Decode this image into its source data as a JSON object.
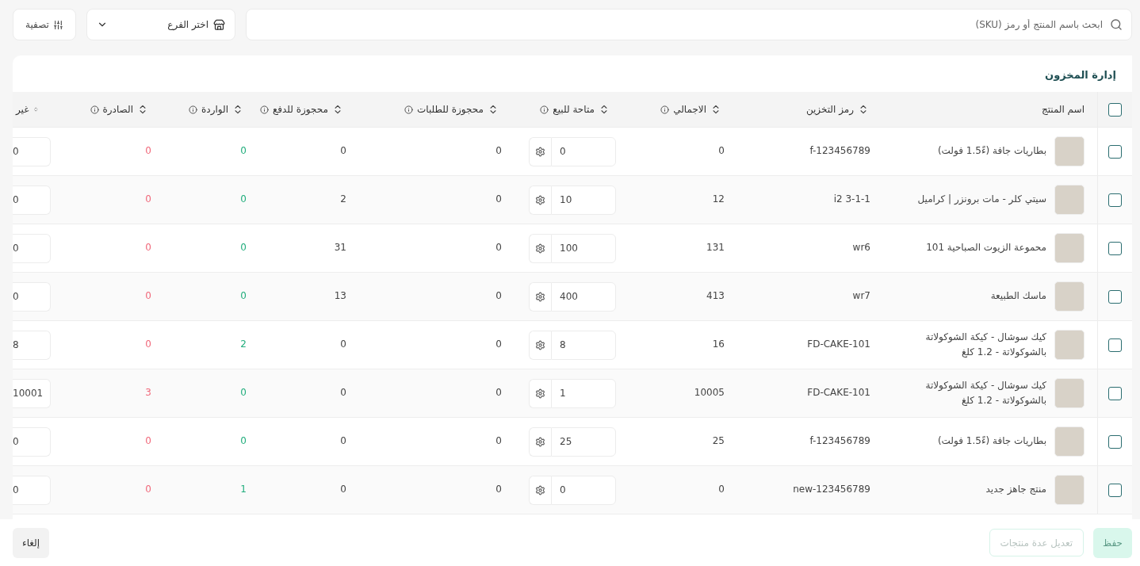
{
  "toolbar": {
    "search": {
      "placeholder": "ابحث باسم المنتج أو رمز (SKU)"
    },
    "branch_select": {
      "placeholder": "اختر الفرع"
    },
    "filter_button": {
      "label": "تصفية"
    }
  },
  "panel": {
    "title": "إدارة المخزون"
  },
  "table": {
    "select_all": {
      "checked": false
    },
    "columns": [
      {
        "label": "اسم المنتج",
        "sortable": false,
        "info": false
      },
      {
        "label": "رمز التخزين",
        "sortable": true,
        "info": false
      },
      {
        "label": "الاجمالي",
        "sortable": true,
        "info": true
      },
      {
        "label": "متاحة للبيع",
        "sortable": true,
        "info": true
      },
      {
        "label": "محجوزة للطلبات",
        "sortable": true,
        "info": true
      },
      {
        "label": "محجوزة للدفع",
        "sortable": true,
        "info": true
      },
      {
        "label": "الواردة",
        "sortable": true,
        "info": true
      },
      {
        "label": "الصادرة",
        "sortable": true,
        "info": true
      },
      {
        "label": "غير",
        "sortable": true,
        "info": false
      }
    ],
    "rows": [
      {
        "checked": false,
        "name": "بطاريات جافة (ءً1.5 فولت)",
        "sku": "f-123456789",
        "total": "0",
        "available": "0",
        "reserved_orders": "0",
        "reserved_payment": "0",
        "incoming": "0",
        "outgoing": "0",
        "column_9": "0"
      },
      {
        "checked": false,
        "name": "سيتي كلر - مات برونزر | كراميل",
        "sku": "i2 3-1-1",
        "total": "12",
        "available": "10",
        "reserved_orders": "0",
        "reserved_payment": "2",
        "incoming": "0",
        "outgoing": "0",
        "column_9": "0"
      },
      {
        "checked": false,
        "name": "محموعة الزيوت الصباحية 101",
        "sku": "wr6",
        "total": "131",
        "available": "100",
        "reserved_orders": "0",
        "reserved_payment": "31",
        "incoming": "0",
        "outgoing": "0",
        "column_9": "0"
      },
      {
        "checked": false,
        "name": "ماسك الطبيعة",
        "sku": "wr7",
        "total": "413",
        "available": "400",
        "reserved_orders": "0",
        "reserved_payment": "13",
        "incoming": "0",
        "outgoing": "0",
        "column_9": "0"
      },
      {
        "checked": false,
        "name": "كيك سوشال - كيكة الشوكولاتة بالشوكولاتة - 1.2 كلغ",
        "sku": "FD-CAKE-101",
        "total": "16",
        "available": "8",
        "reserved_orders": "0",
        "reserved_payment": "0",
        "incoming": "2",
        "outgoing": "0",
        "column_9": "8"
      },
      {
        "checked": false,
        "name": "كيك سوشال - كيكة الشوكولاتة بالشوكولاتة - 1.2 كلغ",
        "sku": "FD-CAKE-101",
        "total": "10005",
        "available": "1",
        "reserved_orders": "0",
        "reserved_payment": "0",
        "incoming": "0",
        "outgoing": "3",
        "column_9": "10001"
      },
      {
        "checked": false,
        "name": "بطاريات جافة (ءً1.5 فولت)",
        "sku": "f-123456789",
        "total": "25",
        "available": "25",
        "reserved_orders": "0",
        "reserved_payment": "0",
        "incoming": "0",
        "outgoing": "0",
        "column_9": "0"
      },
      {
        "checked": false,
        "name": "منتج جاهز جديد",
        "sku": "new-123456789",
        "total": "0",
        "available": "0",
        "reserved_orders": "0",
        "reserved_payment": "0",
        "incoming": "1",
        "outgoing": "0",
        "column_9": "0"
      }
    ]
  },
  "footer": {
    "save_button": {
      "label": "حفظ",
      "disabled": true
    },
    "bulk_edit_button": {
      "label": "تعديل عدة منتجات",
      "disabled": true
    },
    "cancel_button": {
      "label": "إلغاء",
      "disabled": false
    }
  }
}
